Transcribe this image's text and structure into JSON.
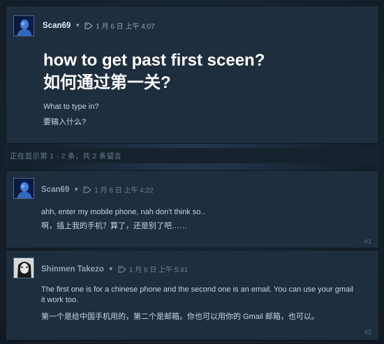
{
  "original_post": {
    "author": "Scan69",
    "date": "1 月 6 日 上午 4:07",
    "title_en": "how to get past first sceen?",
    "title_cn": "如何通过第一关?",
    "body_en": "What to type in?",
    "body_cn": "要输入什么?"
  },
  "comment_count_text": "正在显示第 1 - 2 条，共 2 条留言",
  "comments": [
    {
      "author": "Scan69",
      "date": "1 月 6 日 上午 4:22",
      "text_en": "ahh, enter my mobile phone, nah don't think so..",
      "text_cn": "啊，插上我的手机？算了，还是别了吧……",
      "number": "#1"
    },
    {
      "author": "Shinmen Takezo",
      "date": "1 月 6 日 上午 5:41",
      "text_en_line1": "The first one is for a chinese phone and the second one is an email. You can use your gmail",
      "text_en_line2": "it work too.",
      "text_cn": "第一个是给中国手机用的，第二个是邮箱。你也可以用你的 Gmail 邮箱，也可以。",
      "number": "#2"
    }
  ],
  "icons": {
    "dropdown": "chevron-down-icon",
    "tag": "tag-icon"
  }
}
